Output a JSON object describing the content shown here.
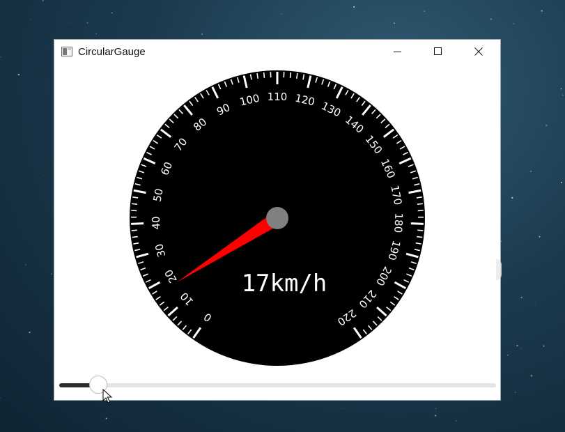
{
  "window": {
    "title": "CircularGauge",
    "controls": {
      "minimize_icon": "minimize-icon",
      "maximize_icon": "maximize-icon",
      "close_icon": "close-icon"
    }
  },
  "gauge": {
    "min": 0,
    "max": 220,
    "major_step": 10,
    "minor_divisions": 5,
    "start_angle_deg": -145,
    "end_angle_deg": 145,
    "value": 17,
    "display_text": "17km/h",
    "colors": {
      "face": "#000000",
      "ticks": "#ffffff",
      "needle": "#ff0000",
      "hub": "#808080"
    },
    "tick_labels": [
      "0",
      "10",
      "20",
      "30",
      "40",
      "50",
      "60",
      "70",
      "80",
      "90",
      "100",
      "110",
      "120",
      "130",
      "140",
      "150",
      "160",
      "170",
      "180",
      "190",
      "200",
      "210",
      "220"
    ]
  },
  "slider": {
    "value_fraction": 0.09,
    "colors": {
      "track": "#e4e4e4",
      "fill": "#2b2b2b"
    }
  }
}
